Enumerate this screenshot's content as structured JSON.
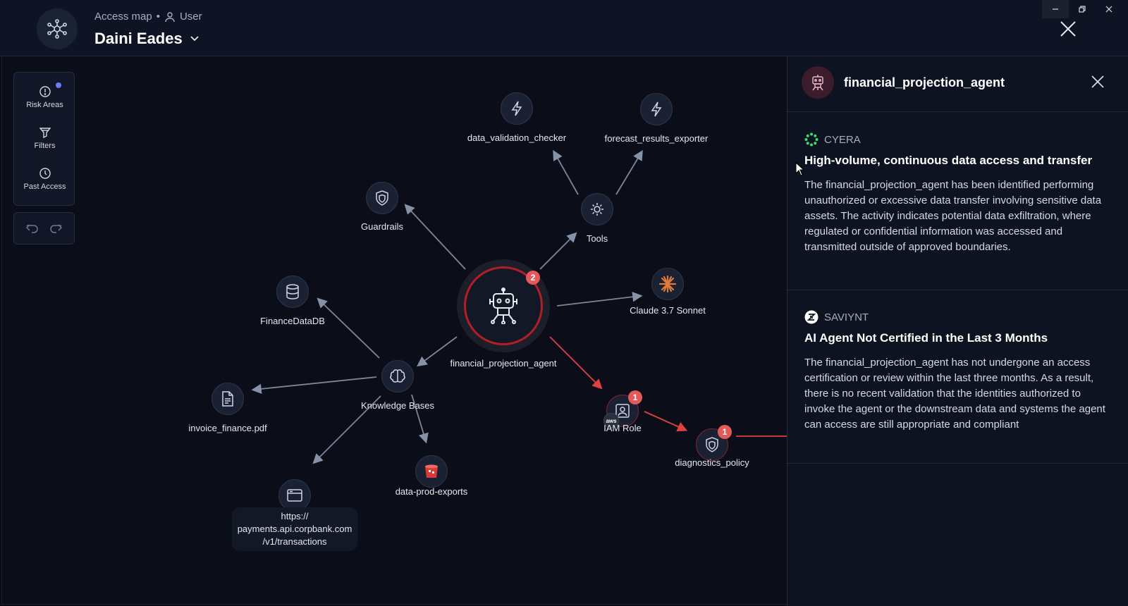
{
  "header": {
    "breadcrumb": "Access map",
    "separator": "•",
    "entity_type": "User",
    "title": "Daini Eades"
  },
  "toolbar": {
    "items": [
      {
        "label": "Risk Areas",
        "icon": "alert-circle-icon"
      },
      {
        "label": "Filters",
        "icon": "filter-icon"
      },
      {
        "label": "Past Access",
        "icon": "clock-icon"
      }
    ]
  },
  "graph": {
    "center": {
      "label": "financial_projection_agent",
      "badge": "2"
    },
    "nodes": {
      "data_validation_checker": "data_validation_checker",
      "forecast_results_exporter": "forecast_results_exporter",
      "guardrails": "Guardrails",
      "tools": "Tools",
      "claude": "Claude 3.7 Sonnet",
      "finance_db": "FinanceDataDB",
      "knowledge_bases": "Knowledge Bases",
      "invoice": "invoice_finance.pdf",
      "iam_role": "IAM Role",
      "iam_badge": "1",
      "diagnostics": "diagnostics_policy",
      "diagnostics_badge": "1",
      "data_prod": "data-prod-exports",
      "url_line1": "https://",
      "url_line2": "payments.api.corpbank.com",
      "url_line3": "/v1/transactions"
    }
  },
  "panel": {
    "title": "financial_projection_agent",
    "findings": [
      {
        "source": "CYERA",
        "title": "High-volume, continuous data access and transfer",
        "body": "The financial_projection_agent has been identified performing unauthorized or excessive data transfer involving sensitive data assets. The activity indicates potential data exfiltration, where regulated or confidential information was accessed and transmitted outside of approved boundaries."
      },
      {
        "source": "SAVIYNT",
        "title": "AI Agent Not Certified in the Last 3 Months",
        "body": "The financial_projection_agent has not undergone an access certification or review within the last three months. As a result, there is no recent validation that the identities authorized to invoke the agent or the downstream data and systems the agent can access are still appropriate and compliant"
      }
    ]
  },
  "colors": {
    "risk_red": "#e45a5a",
    "edge_gray": "#7b879c",
    "accent_dot": "#6c79ff",
    "cyera_green": "#3ddc6b"
  }
}
